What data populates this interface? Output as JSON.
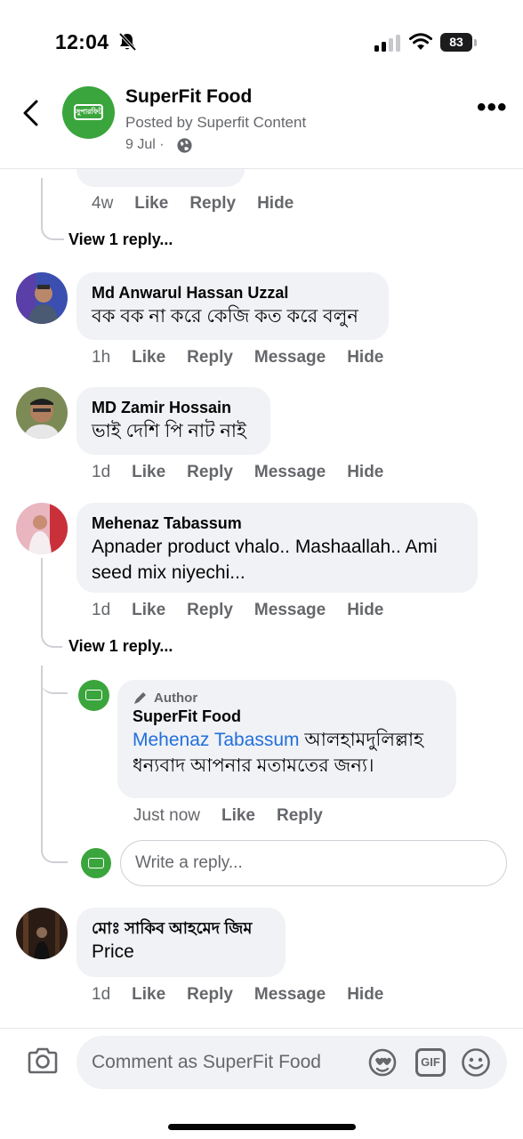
{
  "status_bar": {
    "time": "12:04",
    "battery": "83"
  },
  "header": {
    "page_name": "SuperFit Food",
    "posted_by": "Posted by Superfit Content",
    "date": "9 Jul ·",
    "logo_text": "সুপারফিট"
  },
  "top_comment": {
    "time": "4w",
    "like": "Like",
    "reply": "Reply",
    "hide": "Hide",
    "view_replies": "View 1 reply..."
  },
  "comments": [
    {
      "author": "Md Anwarul Hassan Uzzal",
      "text": "বক বক না করে কেজি কত করে বলুন",
      "time": "1h",
      "like": "Like",
      "reply": "Reply",
      "message": "Message",
      "hide": "Hide"
    },
    {
      "author": "MD Zamir Hossain",
      "text": "ভাই দেশি পি নাট নাই",
      "time": "1d",
      "like": "Like",
      "reply": "Reply",
      "message": "Message",
      "hide": "Hide"
    },
    {
      "author": "Mehenaz Tabassum",
      "text_line1": "Apnader product vhalo.. Mashaallah.. Ami",
      "text_line2": "seed mix niyechi...",
      "time": "1d",
      "like": "Like",
      "reply": "Reply",
      "message": "Message",
      "hide": "Hide",
      "view_replies": "View 1 reply..."
    },
    {
      "author": "মোঃ সাকিব আহমেদ জিম",
      "text": "Price",
      "time": "1d",
      "like": "Like",
      "reply": "Reply",
      "message": "Message",
      "hide": "Hide"
    }
  ],
  "author_reply": {
    "badge": "Author",
    "author": "SuperFit Food",
    "mention": "Mehenaz Tabassum",
    "text_line1": " আলহামদুলিল্লাহ",
    "text_line2": "ধন্যবাদ আপনার মতামতের জন্য।",
    "time": "Just now",
    "like": "Like",
    "reply": "Reply"
  },
  "reply_input": {
    "placeholder": "Write a reply..."
  },
  "composer": {
    "placeholder": "Comment as SuperFit Food",
    "gif_label": "GIF"
  },
  "colors": {
    "brand_green": "#3aa53c",
    "mention_blue": "#216fdb",
    "bubble_bg": "#f0f2f5",
    "meta_gray": "#65676b"
  }
}
